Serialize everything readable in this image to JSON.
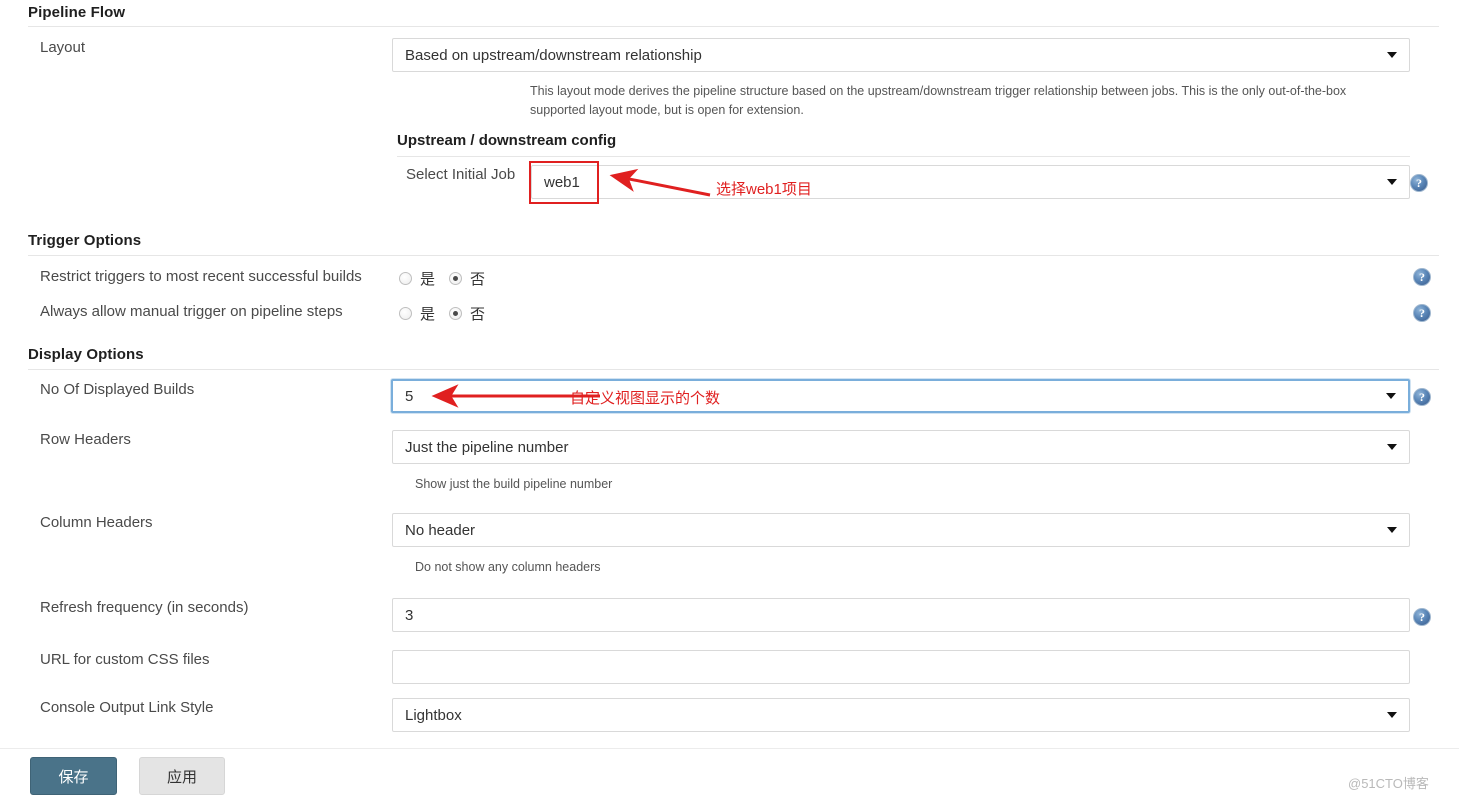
{
  "sections": {
    "pipeline_flow": {
      "title": "Pipeline Flow"
    },
    "trigger_options": {
      "title": "Trigger Options"
    },
    "display_options": {
      "title": "Display Options"
    }
  },
  "pipeline_flow": {
    "layout": {
      "label": "Layout",
      "value": "Based on upstream/downstream relationship",
      "hint": "This layout mode derives the pipeline structure based on the upstream/downstream trigger relationship between jobs. This is the only out-of-the-box supported layout mode, but is open for extension."
    },
    "upstream_config_heading": "Upstream / downstream config",
    "select_initial_job": {
      "label": "Select Initial Job",
      "value": "web1"
    }
  },
  "trigger_options": {
    "restrict_triggers": {
      "label": "Restrict triggers to most recent successful builds",
      "yes_label": "是",
      "no_label": "否",
      "selected": "no"
    },
    "always_allow_manual": {
      "label": "Always allow manual trigger on pipeline steps",
      "yes_label": "是",
      "no_label": "否",
      "selected": "no"
    }
  },
  "display_options": {
    "no_of_displayed_builds": {
      "label": "No Of Displayed Builds",
      "value": "5"
    },
    "row_headers": {
      "label": "Row Headers",
      "value": "Just the pipeline number",
      "hint": "Show just the build pipeline number"
    },
    "column_headers": {
      "label": "Column Headers",
      "value": "No header",
      "hint": "Do not show any column headers"
    },
    "refresh_frequency": {
      "label": "Refresh frequency (in seconds)",
      "value": "3"
    },
    "custom_css_url": {
      "label": "URL for custom CSS files",
      "value": ""
    },
    "console_output_link_style": {
      "label": "Console Output Link Style",
      "value": "Lightbox"
    }
  },
  "annotations": {
    "select_job_note": "选择web1项目",
    "displayed_builds_note": "自定义视图显示的个数",
    "color": "#e02020"
  },
  "footer": {
    "save_label": "保存",
    "apply_label": "应用",
    "watermark": "@51CTO博客"
  },
  "icons": {
    "help": "?"
  }
}
